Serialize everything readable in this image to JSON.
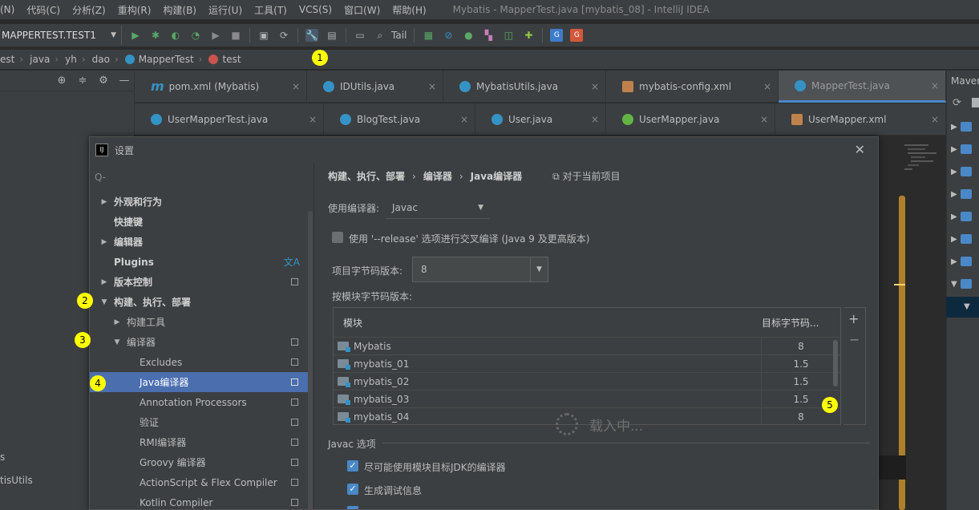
{
  "menubar": {
    "items": [
      "(N)",
      "代码(C)",
      "分析(Z)",
      "重构(R)",
      "构建(B)",
      "运行(U)",
      "工具(T)",
      "VCS(S)",
      "窗口(W)",
      "帮助(H)"
    ],
    "title": "Mybatis - MapperTest.java [mybatis_08] - IntelliJ IDEA"
  },
  "toolbar": {
    "run_config": "MAPPERTEST.TEST1",
    "tail_label": "Tail"
  },
  "breadcrumb": [
    "est",
    "java",
    "yh",
    "dao",
    "MapperTest",
    "test"
  ],
  "editor_tabs": {
    "row1": [
      "pom.xml (Mybatis)",
      "IDUtils.java",
      "MybatisUtils.java",
      "mybatis-config.xml",
      "MapperTest.java"
    ],
    "row2": [
      "UserMapperTest.java",
      "BlogTest.java",
      "User.java",
      "UserMapper.java",
      "UserMapper.xml"
    ]
  },
  "maven": {
    "title": "Maven"
  },
  "left_panel": {
    "partial_labels": [
      "s",
      "tisUtils"
    ]
  },
  "dialog": {
    "title": "设置",
    "search_placeholder": "Q-",
    "tree": {
      "appearance": "外观和行为",
      "keymap": "快捷键",
      "editor": "编辑器",
      "plugins": "Plugins",
      "vcs": "版本控制",
      "build": "构建、执行、部署",
      "build_tools": "构建工具",
      "compiler": "编译器",
      "excludes": "Excludes",
      "java_compiler": "Java编译器",
      "annotation": "Annotation Processors",
      "validation": "验证",
      "rmi": "RMI编译器",
      "groovy": "Groovy 编译器",
      "actionscript": "ActionScript & Flex Compiler",
      "kotlin": "Kotlin Compiler"
    },
    "content": {
      "crumb_1": "构建、执行、部署",
      "crumb_2": "编译器",
      "crumb_3": "Java编译器",
      "scope": "对于当前项目",
      "use_compiler_label": "使用编译器:",
      "use_compiler_value": "Javac",
      "release_option": "使用 '--release' 选项进行交叉编译 (Java 9 及更高版本)",
      "project_bytecode_label": "项目字节码版本:",
      "project_bytecode_value": "8",
      "per_module_label": "按模块字节码版本:",
      "table": {
        "headers": [
          "模块",
          "目标字节码..."
        ],
        "rows": [
          {
            "module": "Mybatis",
            "target": "8"
          },
          {
            "module": "mybatis_01",
            "target": "1.5"
          },
          {
            "module": "mybatis_02",
            "target": "1.5"
          },
          {
            "module": "mybatis_03",
            "target": "1.5"
          },
          {
            "module": "mybatis_04",
            "target": "8"
          }
        ]
      },
      "loading": "载入中...",
      "javac_section": "Javac 选项",
      "javac_opt1": "尽可能使用模块目标JDK的编译器",
      "javac_opt2": "生成调试信息"
    }
  },
  "markers": [
    "1",
    "2",
    "3",
    "4",
    "5"
  ],
  "colors": {
    "accent": "#4b6eaf",
    "marker": "#ffff00",
    "panel": "#3c3f41",
    "editor": "#2b2b2b"
  }
}
